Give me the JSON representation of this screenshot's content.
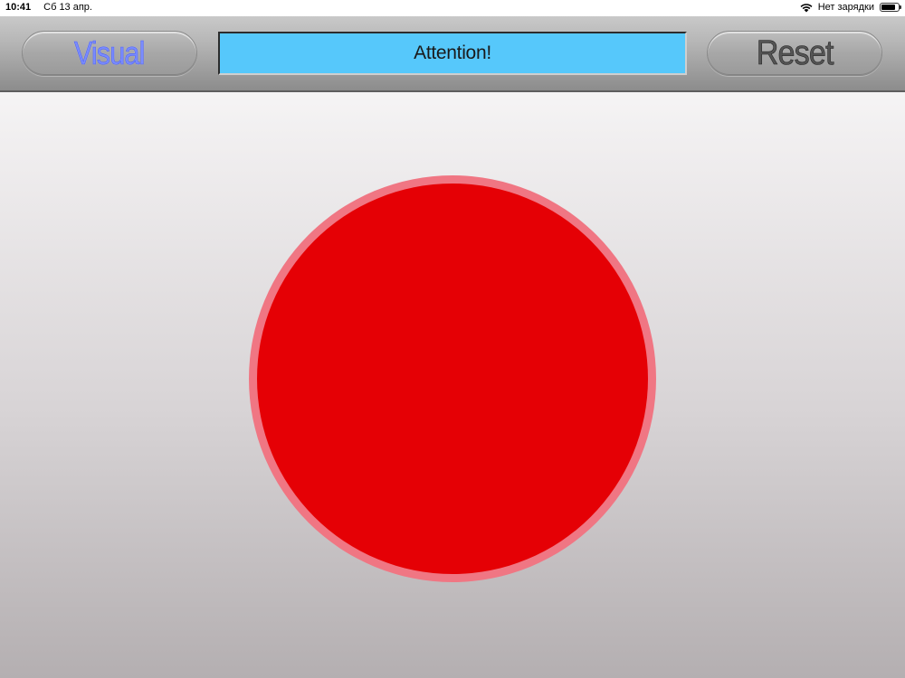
{
  "status_bar": {
    "time": "10:41",
    "date": "Сб 13 апр.",
    "charging_text": "Нет зарядки",
    "battery_level": 0.85
  },
  "toolbar": {
    "visual_label": "Visual",
    "reset_label": "Reset",
    "message": "Attention!"
  },
  "indicator": {
    "state_color": "#e50005",
    "ring_color": "#f07683"
  },
  "colors": {
    "message_background": "#56c8fb",
    "visual_text": "#7a8cff"
  },
  "icons": {
    "wifi": "wifi-icon",
    "battery": "battery-icon"
  }
}
